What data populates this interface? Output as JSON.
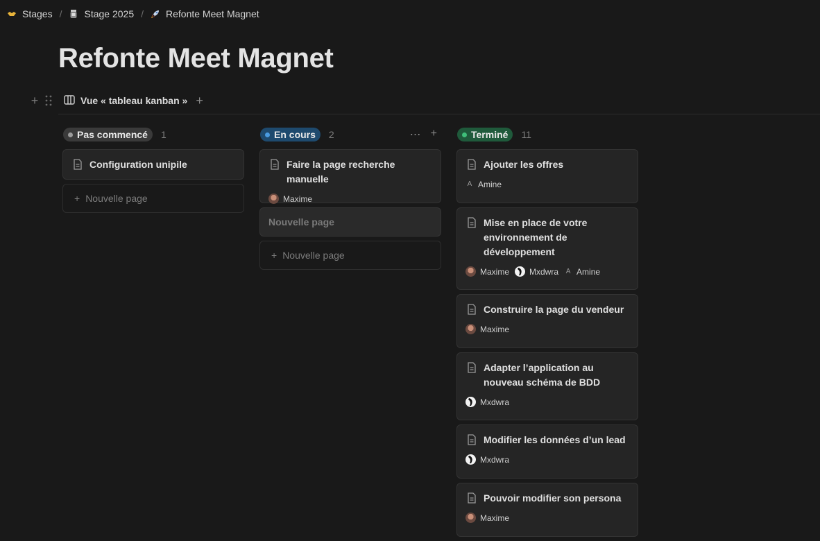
{
  "breadcrumb": [
    {
      "icon": "handshake-icon",
      "label": "Stages"
    },
    {
      "icon": "jar-icon",
      "label": "Stage 2025"
    },
    {
      "icon": "rocket-icon",
      "label": "Refonte Meet Magnet"
    }
  ],
  "page_title": "Refonte Meet Magnet",
  "view": {
    "label": "Vue « tableau kanban »"
  },
  "new_page_label": "Nouvelle page",
  "columns": [
    {
      "name": "Pas commencé",
      "count": "1",
      "color": "#3a3a3a",
      "dot": "#9b9b9b",
      "cards": [
        {
          "title": "Configuration unipile",
          "people": []
        }
      ]
    },
    {
      "name": "En cours",
      "count": "2",
      "color": "#1e4a6e",
      "dot": "#4a9be0",
      "draft": "Nouvelle page",
      "cards": [
        {
          "title": "Faire la page recherche manuelle",
          "people": [
            {
              "name": "Maxime",
              "avatar": "photo"
            }
          ]
        }
      ]
    },
    {
      "name": "Terminé",
      "count": "11",
      "color": "#1f5a3b",
      "dot": "#3fbf7a",
      "cards": [
        {
          "title": "Ajouter les offres",
          "people": [
            {
              "name": "Amine",
              "avatar": "letter",
              "initial": "A"
            }
          ]
        },
        {
          "title": "Mise en place de votre environnement de développement",
          "people": [
            {
              "name": "Maxime",
              "avatar": "photo"
            },
            {
              "name": "Mxdwra",
              "avatar": "bw"
            },
            {
              "name": "Amine",
              "avatar": "letter",
              "initial": "A"
            }
          ]
        },
        {
          "title": "Construire la page du vendeur",
          "people": [
            {
              "name": "Maxime",
              "avatar": "photo"
            }
          ]
        },
        {
          "title": "Adapter l’application au nouveau schéma de BDD",
          "people": [
            {
              "name": "Mxdwra",
              "avatar": "bw"
            }
          ]
        },
        {
          "title": "Modifier les données d’un lead",
          "people": [
            {
              "name": "Mxdwra",
              "avatar": "bw"
            }
          ]
        },
        {
          "title": "Pouvoir modifier son persona",
          "people": [
            {
              "name": "Maxime",
              "avatar": "photo"
            }
          ]
        }
      ]
    }
  ]
}
